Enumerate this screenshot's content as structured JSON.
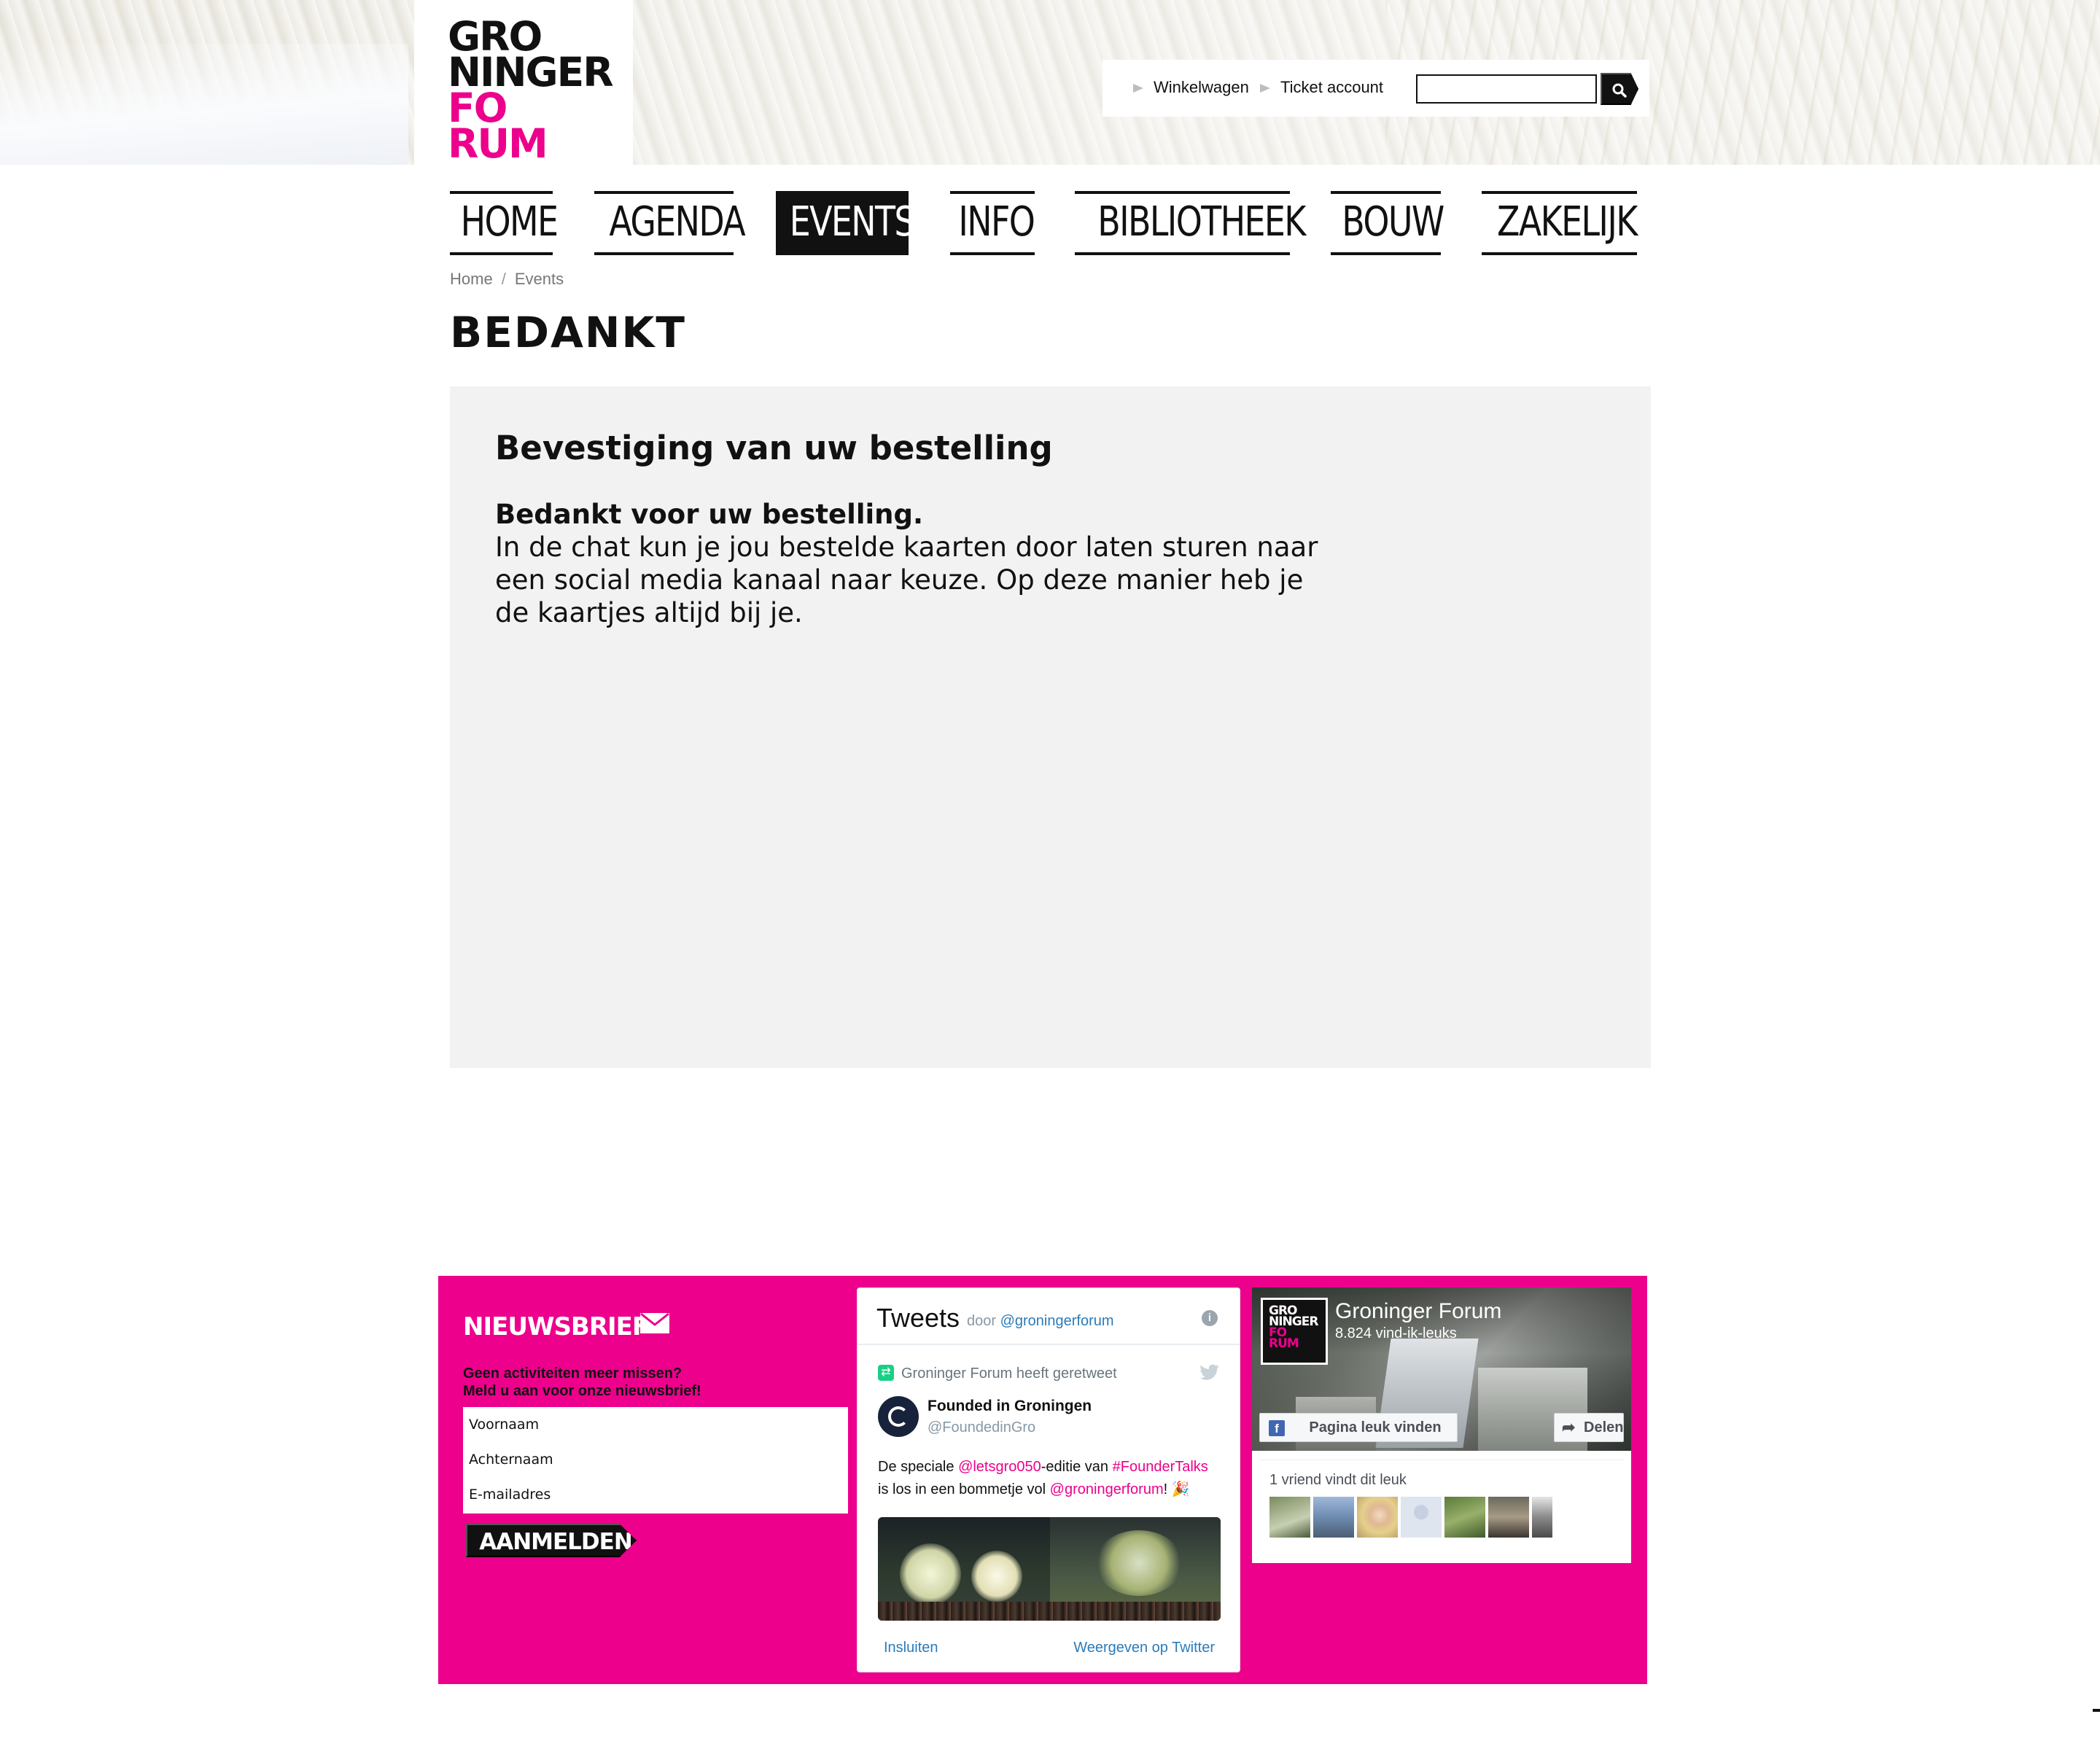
{
  "brand": {
    "logo_lines": [
      "GRO",
      "NINGER",
      "FO",
      "RUM"
    ],
    "accent_color": "#ec008c"
  },
  "utility": {
    "cart_label": "Winkelwagen",
    "account_label": "Ticket account",
    "search_placeholder": "",
    "search_icon": "search-icon"
  },
  "nav": {
    "items": [
      {
        "label": "HOME",
        "active": false
      },
      {
        "label": "AGENDA",
        "active": false
      },
      {
        "label": "EVENTS",
        "active": true
      },
      {
        "label": "INFO",
        "active": false
      },
      {
        "label": "BIBLIOTHEEK",
        "active": false
      },
      {
        "label": "BOUW",
        "active": false
      },
      {
        "label": "ZAKELIJK",
        "active": false
      }
    ]
  },
  "breadcrumb": {
    "items": [
      "Home",
      "Events"
    ],
    "separator": "/"
  },
  "page": {
    "title": "BEDANKT"
  },
  "confirmation": {
    "heading": "Bevestiging van uw bestelling",
    "thanks": "Bedankt voor uw bestelling.",
    "body": "In de chat kun je jou bestelde kaarten door laten sturen naar een social media kanaal naar keuze. Op deze manier heb je de kaartjes altijd bij je."
  },
  "newsletter": {
    "title": "NIEUWSBRIEF",
    "subtitle_line1": "Geen activiteiten meer missen?",
    "subtitle_line2": "Meld u aan voor onze nieuwsbrief!",
    "firstname_placeholder": "Voornaam",
    "lastname_placeholder": "Achternaam",
    "email_placeholder": "E-mailadres",
    "submit_label": "AANMELDEN"
  },
  "twitter": {
    "title": "Tweets",
    "by_prefix": "door",
    "by_handle": "@groningerforum",
    "retweet_label": "Groninger Forum heeft geretweet",
    "author_name": "Founded in Groningen",
    "author_handle": "@FoundedinGro",
    "tweet_parts": {
      "t1": "De speciale ",
      "m1": "@letsgro050",
      "t2": "-editie van ",
      "m2": "#FounderTalks",
      "t3": " is los in een bommetje vol ",
      "m3": "@groningerforum",
      "t4": "! 🎉"
    },
    "embed_label": "Insluiten",
    "view_label": "Weergeven op Twitter"
  },
  "facebook": {
    "page_name": "Groninger Forum",
    "likes": "8.824 vind-ik-leuks",
    "like_button": "Pagina leuk vinden",
    "share_button": "Delen",
    "friends_text": "1 vriend vindt dit leuk"
  }
}
